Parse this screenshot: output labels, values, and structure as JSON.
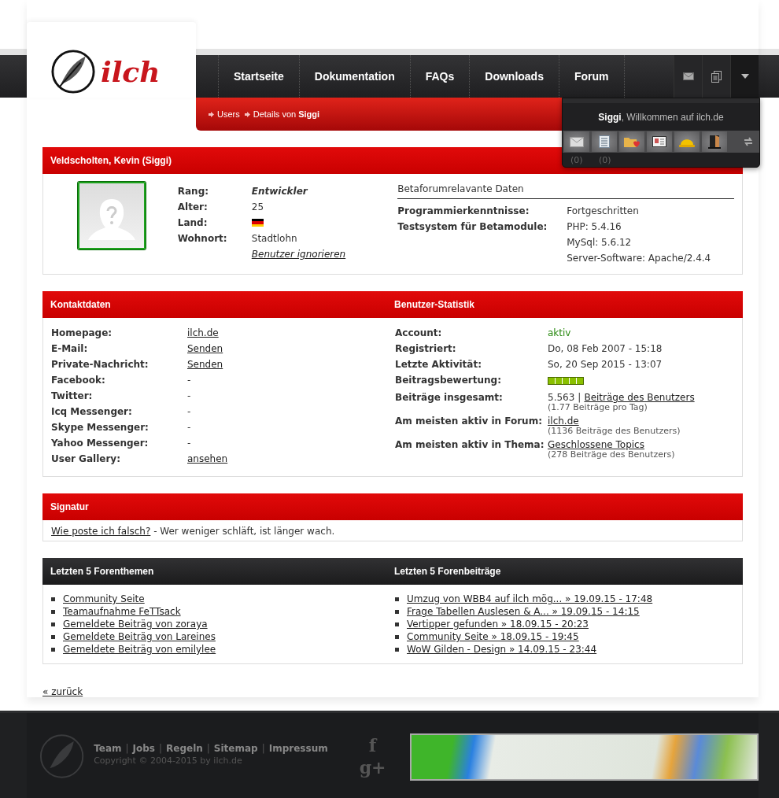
{
  "logo": {
    "text": "ilch"
  },
  "nav": [
    {
      "label": "Startseite"
    },
    {
      "label": "Dokumentation"
    },
    {
      "label": "FAQs"
    },
    {
      "label": "Downloads"
    },
    {
      "label": "Forum"
    }
  ],
  "breadcrumb": [
    "Users",
    "Details von **Siggi**"
  ],
  "user_menu": {
    "greeting": "**Siggi**, Willkommen auf ilch.de",
    "counts": [
      "(0)",
      "(0)"
    ]
  },
  "profile": {
    "title": "Veldscholten, Kevin (Siggi)",
    "fields": [
      {
        "label": "Rang:",
        "value": "Entwickler",
        "kind": "rank"
      },
      {
        "label": "Alter:",
        "value": "25",
        "kind": "text"
      },
      {
        "label": "Land:",
        "kind": "flag"
      },
      {
        "label": "Wohnort:",
        "value": "Stadtlohn",
        "kind": "text"
      }
    ],
    "ignore_link": "Benutzer ignorieren",
    "beta": {
      "title": "Betaforumrelavante Daten",
      "rows": [
        {
          "label": "Programmierkenntnisse:",
          "values": [
            "Fortgeschritten"
          ]
        },
        {
          "label": "Testsystem für Betamodule:",
          "values": [
            "PHP: 5.4.16",
            "MySql: 5.6.12",
            "Server-Software: Apache/2.4.4"
          ]
        }
      ]
    }
  },
  "contact": {
    "title": "Kontaktdaten",
    "rows": [
      {
        "label": "Homepage:",
        "value": "ilch.de",
        "kind": "link"
      },
      {
        "label": "E-Mail:",
        "value": "Senden",
        "kind": "link"
      },
      {
        "label": "Private-Nachricht:",
        "value": "Senden",
        "kind": "link"
      },
      {
        "label": "Facebook:",
        "value": "-",
        "kind": "text"
      },
      {
        "label": "Twitter:",
        "value": "-",
        "kind": "text"
      },
      {
        "label": "Icq Messenger:",
        "value": "-",
        "kind": "text"
      },
      {
        "label": "Skype Messenger:",
        "value": "-",
        "kind": "text"
      },
      {
        "label": "Yahoo Messenger:",
        "value": "-",
        "kind": "text"
      },
      {
        "label": "User Gallery:",
        "value": "ansehen",
        "kind": "link"
      }
    ]
  },
  "stats": {
    "title": "Benutzer-Statistik",
    "rows": [
      {
        "label": "Account:",
        "value": "aktiv",
        "kind": "status"
      },
      {
        "label": "Registriert:",
        "value": "Do, 08 Feb 2007 - 15:18",
        "kind": "text"
      },
      {
        "label": "Letzte Aktivität:",
        "value": "So, 20 Sep 2015 - 13:07",
        "kind": "text"
      },
      {
        "label": "Beitragsbewertung:",
        "stars": 5,
        "kind": "rating"
      },
      {
        "label": "Beiträge insgesamt:",
        "value": "5.563",
        "separator": "|",
        "link": "Beiträge des Benutzers",
        "note": "(1.77 Beiträge pro Tag)",
        "kind": "count"
      },
      {
        "label": "Am meisten aktiv in Forum:",
        "link": "ilch.de",
        "note": "(1136 Beiträge des Benutzers)",
        "kind": "link"
      },
      {
        "label": "Am meisten aktiv in Thema:",
        "link": "Geschlossene Topics",
        "note": "(278 Beiträge des Benutzers)",
        "kind": "link"
      }
    ]
  },
  "signature": {
    "title": "Signatur",
    "link": "Wie poste ich falsch?",
    "text": " - Wer weniger schläft, ist länger wach."
  },
  "recent_topics": {
    "title": "Letzten 5 Forenthemen",
    "items": [
      "Community Seite",
      "Teamaufnahme FeTTsack",
      "Gemeldete Beiträg von zoraya",
      "Gemeldete Beiträg von Lareines",
      "Gemeldete Beiträg von emilylee"
    ]
  },
  "recent_posts": {
    "title": "Letzten 5 Forenbeiträge",
    "items": [
      "Umzug von WBB4 auf ilch mög... » 19.09.15 - 17:48",
      "Frage Tabellen Auslesen & A... » 19.09.15 - 14:15",
      "Vertipper gefunden » 18.09.15 - 20:23",
      "Community Seite » 18.09.15 - 19:45",
      "WoW Gilden - Design » 14.09.15 - 23:44"
    ]
  },
  "back_link": "« zurück",
  "footer": {
    "links": [
      "Team",
      "Jobs",
      "Regeln",
      "Sitemap",
      "Impressum"
    ],
    "separator": "|",
    "copyright": "Copyright © 2004-2015 by ilch.de",
    "social": [
      "f",
      "g+"
    ]
  }
}
